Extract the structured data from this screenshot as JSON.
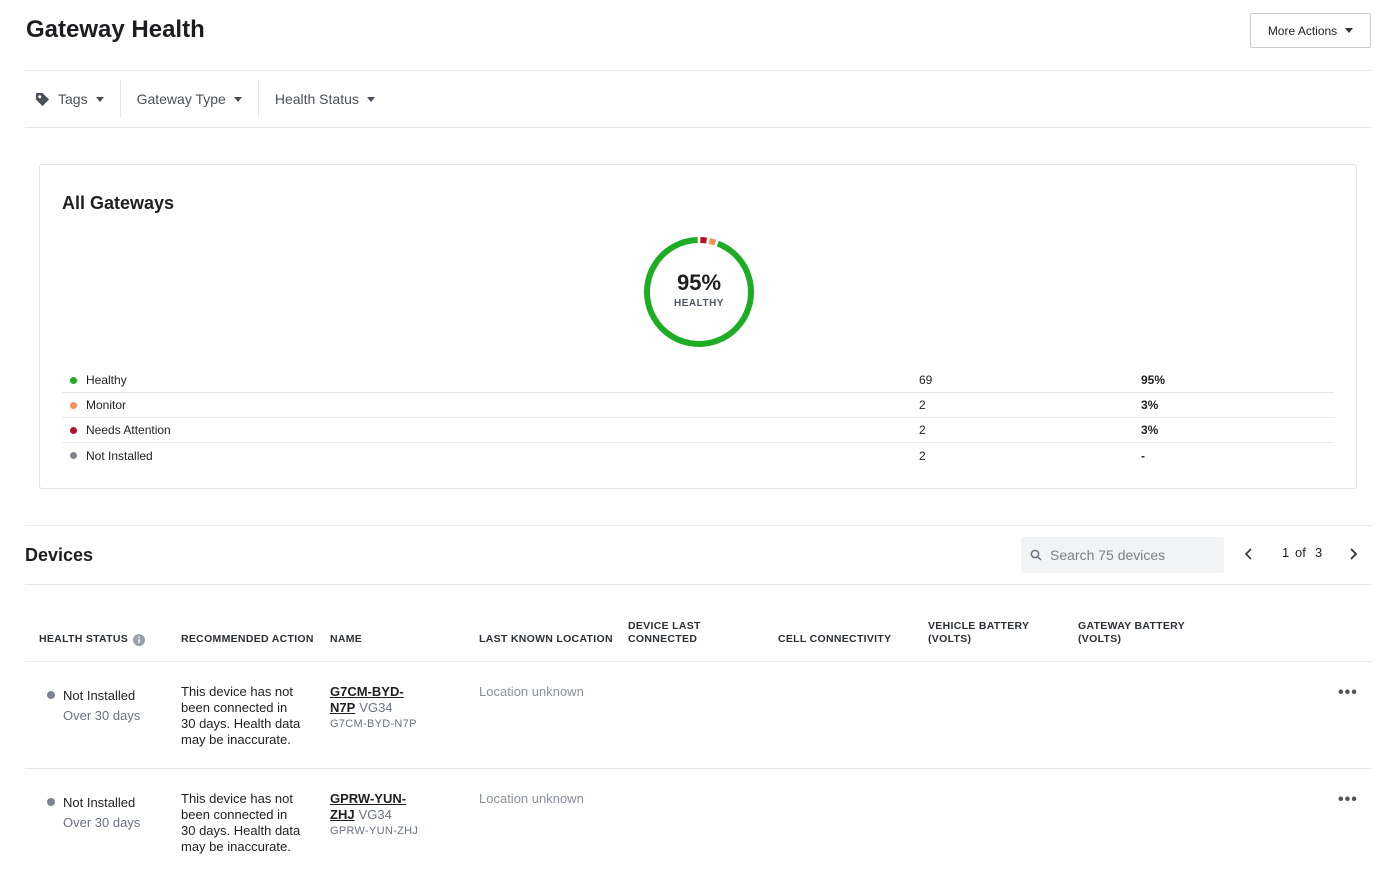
{
  "header": {
    "title": "Gateway Health",
    "more_actions": "More Actions"
  },
  "filters": [
    {
      "label": "Tags",
      "icon": "tag-icon"
    },
    {
      "label": "Gateway Type"
    },
    {
      "label": "Health Status"
    }
  ],
  "summary": {
    "title": "All Gateways",
    "donut_percent": "95%",
    "donut_label": "HEALTHY",
    "chart_data": {
      "type": "pie",
      "categories": [
        "Healthy",
        "Monitor",
        "Needs Attention"
      ],
      "values": [
        69,
        2,
        2
      ],
      "colors": [
        "#1cad23",
        "#f2915a",
        "#b3122a"
      ]
    },
    "legend": [
      {
        "label": "Healthy",
        "count": "69",
        "percent": "95%",
        "color": "#1cad23"
      },
      {
        "label": "Monitor",
        "count": "2",
        "percent": "3%",
        "color": "#f2915a"
      },
      {
        "label": "Needs Attention",
        "count": "2",
        "percent": "3%",
        "color": "#b3122a"
      },
      {
        "label": "Not Installed",
        "count": "2",
        "percent": "-",
        "color": "#808690"
      }
    ]
  },
  "devices": {
    "title": "Devices",
    "search_placeholder": "Search 75 devices",
    "pager": {
      "current": "1",
      "of": "of",
      "total": "3"
    },
    "columns": {
      "health_status": "HEALTH STATUS",
      "recommended_action": "RECOMMENDED ACTION",
      "name": "NAME",
      "last_known_location": "LAST KNOWN LOCATION",
      "device_last_connected_1": "DEVICE LAST",
      "device_last_connected_2": "CONNECTED",
      "cell_connectivity": "CELL CONNECTIVITY",
      "vehicle_battery_1": "VEHICLE BATTERY",
      "vehicle_battery_2": "(VOLTS)",
      "gateway_battery_1": "GATEWAY BATTERY",
      "gateway_battery_2": "(VOLTS)"
    },
    "rows": [
      {
        "status": "Not Installed",
        "status_sub": "Over 30 days",
        "action_1": "This device has not",
        "action_2": "been connected in",
        "action_3": "30 days. Health data",
        "action_4": "may be inaccurate.",
        "name_1": "G7CM-BYD-",
        "name_2": "N7P",
        "model": "VG34",
        "serial": "G7CM-BYD-N7P",
        "location": "Location unknown"
      },
      {
        "status": "Not Installed",
        "status_sub": "Over 30 days",
        "action_1": "This device has not",
        "action_2": "been connected in",
        "action_3": "30 days. Health data",
        "action_4": "may be inaccurate.",
        "name_1": "GPRW-YUN-",
        "name_2": "ZHJ",
        "model": "VG34",
        "serial": "GPRW-YUN-ZHJ",
        "location": "Location unknown"
      }
    ]
  }
}
